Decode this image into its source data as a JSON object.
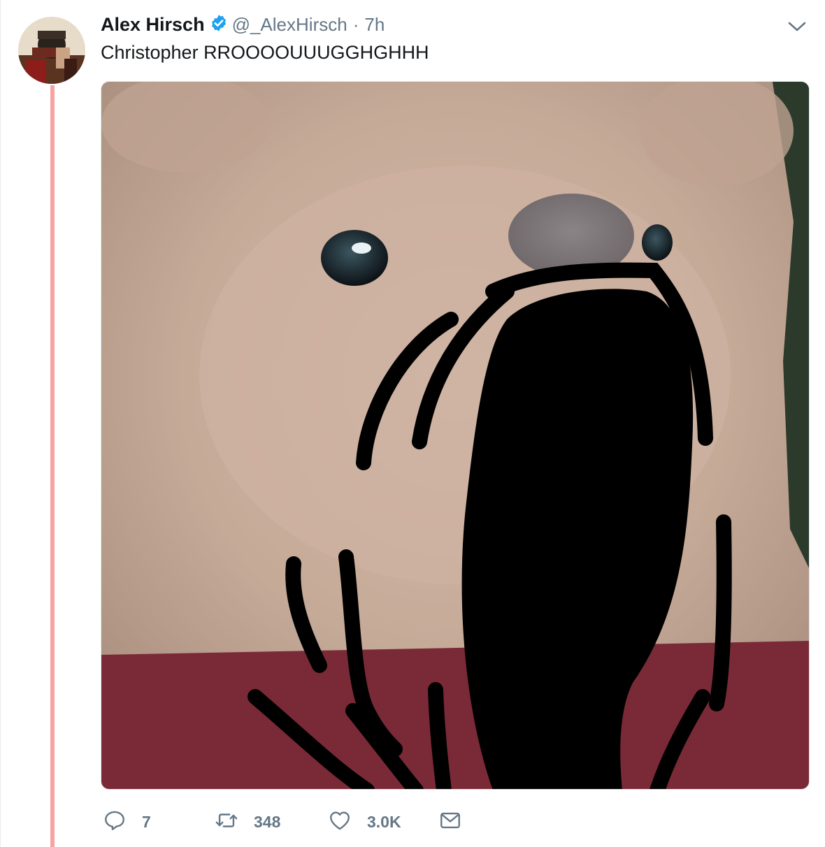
{
  "tweet": {
    "author_name": "Alex Hirsch",
    "handle": "@_AlexHirsch",
    "separator": "·",
    "time": "7h",
    "text": "Christopher RROOOOUUUGGHGHHH",
    "verified": true
  },
  "icons": {
    "verified": "verified-badge-icon",
    "menu": "chevron-down-icon",
    "reply": "reply-icon",
    "retweet": "retweet-icon",
    "like": "heart-icon",
    "dm": "envelope-icon"
  },
  "actions": {
    "reply_count": "7",
    "retweet_count": "348",
    "like_count": "3.0K"
  },
  "colors": {
    "verified": "#1da1f2",
    "thread_line": "#f7a3a5",
    "secondary_text": "#657786",
    "primary_text": "#14171a"
  }
}
